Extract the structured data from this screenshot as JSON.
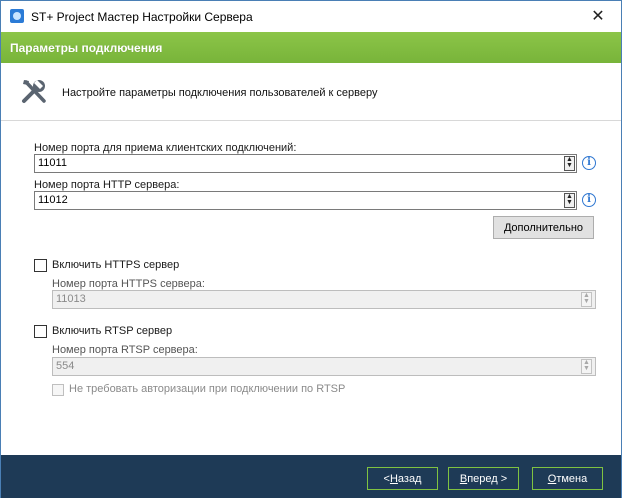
{
  "window": {
    "title": "ST+ Project Мастер Настройки Сервера",
    "close": "✕"
  },
  "header": {
    "title": "Параметры подключения"
  },
  "intro": {
    "text": "Настройте параметры подключения пользователей к серверу",
    "icon": "tools-icon"
  },
  "client_port": {
    "label": "Номер порта для приема клиентских подключений:",
    "value": "11011"
  },
  "http_port": {
    "label": "Номер порта HTTP сервера:",
    "value": "11012"
  },
  "advanced_button": {
    "label_prefix": "Д",
    "label_rest": "ополнительно"
  },
  "https": {
    "checkbox_label": "Включить HTTPS сервер",
    "port_label": "Номер порта HTTPS сервера:",
    "port_value": "11013",
    "checked": false
  },
  "rtsp": {
    "checkbox_label": "Включить RTSP сервер",
    "port_label": "Номер порта RTSP сервера:",
    "port_value": "554",
    "checked": false,
    "no_auth_label": "Не требовать авторизации при подключении по RTSP"
  },
  "footer": {
    "back_prefix": "< ",
    "back_key": "Н",
    "back_rest": "азад",
    "next_key": "В",
    "next_rest": "перед >",
    "cancel_key": "О",
    "cancel_rest": "тмена"
  },
  "colors": {
    "header_green": "#80bc3f",
    "footer_navy": "#1e3a56",
    "footer_button_border": "#7fc241",
    "info_blue": "#2f77d1"
  }
}
